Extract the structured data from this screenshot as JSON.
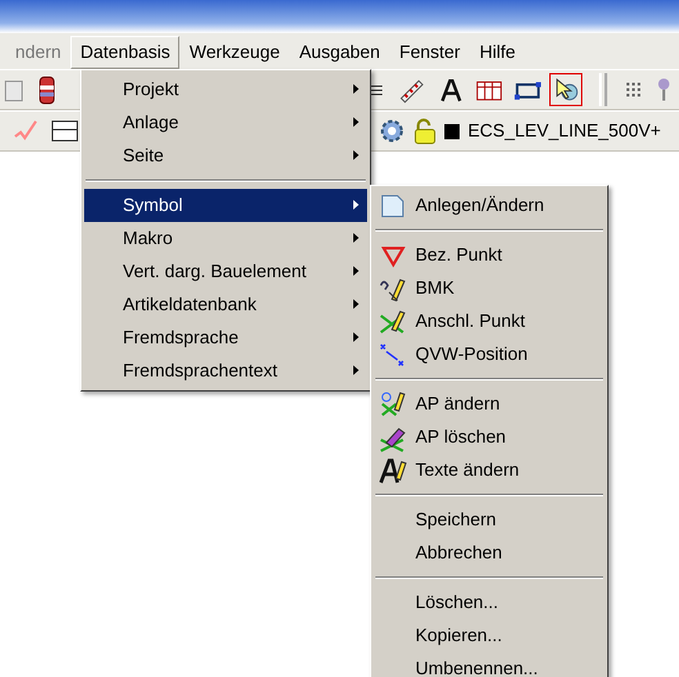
{
  "menu_bar": [
    {
      "label": "ndern",
      "open": false
    },
    {
      "label": "Datenbasis",
      "open": true
    },
    {
      "label": "Werkzeuge",
      "open": false
    },
    {
      "label": "Ausgaben",
      "open": false
    },
    {
      "label": "Fenster",
      "open": false
    },
    {
      "label": "Hilfe",
      "open": false
    }
  ],
  "toolbar_1": {
    "tools": [
      {
        "selected": false
      },
      {
        "selected": false
      },
      {
        "selected": false
      },
      {
        "selected": false
      },
      {
        "selected": false
      },
      {
        "selected": true
      }
    ]
  },
  "toolbar_2": {
    "layer_name": "ECS_LEV_LINE_500V+"
  },
  "dropdown": {
    "items": [
      {
        "kind": "item",
        "label": "Projekt",
        "selected": false
      },
      {
        "kind": "item",
        "label": "Anlage",
        "selected": false
      },
      {
        "kind": "item",
        "label": "Seite",
        "selected": false
      },
      {
        "kind": "separator"
      },
      {
        "kind": "item",
        "label": "Symbol",
        "selected": true
      },
      {
        "kind": "item",
        "label": "Makro",
        "selected": false
      },
      {
        "kind": "item",
        "label": "Vert. darg. Bauelement",
        "selected": false
      },
      {
        "kind": "item",
        "label": "Artikeldatenbank",
        "selected": false
      },
      {
        "kind": "item",
        "label": "Fremdsprache",
        "selected": false
      },
      {
        "kind": "item",
        "label": "Fremdsprachentext",
        "selected": false
      }
    ]
  },
  "submenu": {
    "items": [
      {
        "kind": "icon-item",
        "label": "Anlegen/Ändern"
      },
      {
        "kind": "separator"
      },
      {
        "kind": "icon-item",
        "label": "Bez. Punkt"
      },
      {
        "kind": "icon-item",
        "label": "BMK"
      },
      {
        "kind": "icon-item",
        "label": "Anschl. Punkt"
      },
      {
        "kind": "icon-item",
        "label": "QVW-Position"
      },
      {
        "kind": "separator"
      },
      {
        "kind": "icon-item",
        "label": "AP ändern"
      },
      {
        "kind": "icon-item",
        "label": "AP löschen"
      },
      {
        "kind": "icon-item",
        "label": "Texte ändern"
      },
      {
        "kind": "separator"
      },
      {
        "kind": "item",
        "label": "Speichern"
      },
      {
        "kind": "item",
        "label": "Abbrechen"
      },
      {
        "kind": "separator"
      },
      {
        "kind": "item",
        "label": "Löschen..."
      },
      {
        "kind": "item",
        "label": "Kopieren..."
      },
      {
        "kind": "item",
        "label": "Umbenennen..."
      }
    ]
  }
}
